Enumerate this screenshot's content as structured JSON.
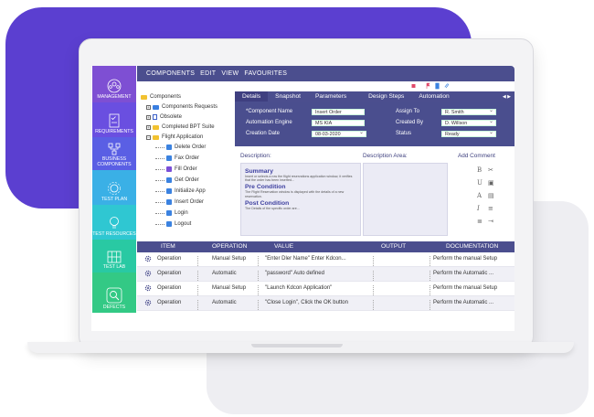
{
  "modules": [
    {
      "label": "MANAGEMENT",
      "icon": "group-icon"
    },
    {
      "label": "REQUIREMENTS",
      "icon": "checklist-icon"
    },
    {
      "label": "BUSINESS COMPONENTS",
      "icon": "hierarchy-icon"
    },
    {
      "label": "TEST PLAN",
      "icon": "gear-plan-icon"
    },
    {
      "label": "TEST RESOURCES",
      "icon": "bulb-icon"
    },
    {
      "label": "TEST LAB",
      "icon": "grid-icon"
    },
    {
      "label": "DEFECTS",
      "icon": "magnifier-icon"
    }
  ],
  "menu": {
    "items": [
      "COMPONENTS",
      "EDIT",
      "VIEW",
      "FAVOURITES"
    ]
  },
  "tree": {
    "root": "Components",
    "items": [
      {
        "label": "Components Requests",
        "kind": "request-folder"
      },
      {
        "label": "Obsolete",
        "kind": "obsolete"
      },
      {
        "label": "Completed BPT Suite",
        "kind": "folder"
      },
      {
        "label": "Flight Application",
        "kind": "folder"
      },
      {
        "label": "Delete Order",
        "kind": "component"
      },
      {
        "label": "Fax Order",
        "kind": "component"
      },
      {
        "label": "Fill Order",
        "kind": "component"
      },
      {
        "label": "Get Order",
        "kind": "component"
      },
      {
        "label": "Initialize App",
        "kind": "component"
      },
      {
        "label": "Insert Order",
        "kind": "component"
      },
      {
        "label": "Login",
        "kind": "component"
      },
      {
        "label": "Logout",
        "kind": "component"
      }
    ]
  },
  "tabs": [
    "Details",
    "Snapshot",
    "Parameters",
    "Design Steps",
    "Automation"
  ],
  "details": {
    "component_name_label": "*Component Name",
    "component_name": "Insert Order",
    "automation_engine_label": "Automation Engine",
    "automation_engine": "MS KIA",
    "creation_date_label": "Creation Date",
    "creation_date": "08-03-2020",
    "assign_to_label": "Assign To",
    "assign_to": "R. Smith",
    "created_by_label": "Created By",
    "created_by": "D. Willson",
    "status_label": "Status",
    "status": "Ready"
  },
  "description": {
    "title": "Description:",
    "area_title": "Description Area:",
    "comment_label": "Add Comment",
    "summary_title": "Summary",
    "summary_text": "Insert or selects a row the flight reservations application window, it verifies that the order has been inserted...",
    "pre_title": "Pre Condition",
    "pre_text": "The Flight Reservation window is displayed with the details of a new reservation.",
    "post_title": "Post Condition",
    "post_text": "The Details of the specific order are..."
  },
  "grid": {
    "headers": [
      "ITEM",
      "OPERATION",
      "VALUE",
      "OUTPUT",
      "DOCUMENTATION"
    ],
    "rows": [
      {
        "item": "Operation",
        "operation": "Manual Setup",
        "value": "\"Enter Dler Name\" Enter Kdcon...",
        "doc": "Perform the manual Setup"
      },
      {
        "item": "Operation",
        "operation": "Automatic",
        "value": "\"password\" Auto defined",
        "doc": "Perform the Automatic ..."
      },
      {
        "item": "Operation",
        "operation": "Manual Setup",
        "value": "\"Launch Kdcon Application\"",
        "doc": "Perform the manual Setup"
      },
      {
        "item": "Operation",
        "operation": "Automatic",
        "value": "\"Close Login\", Click the OK button",
        "doc": "Perform the Automatic ..."
      }
    ]
  },
  "colors": {
    "primary": "#4b4e8e",
    "purple_blob": "#5b3fd0",
    "accent": "#3b82e0"
  }
}
